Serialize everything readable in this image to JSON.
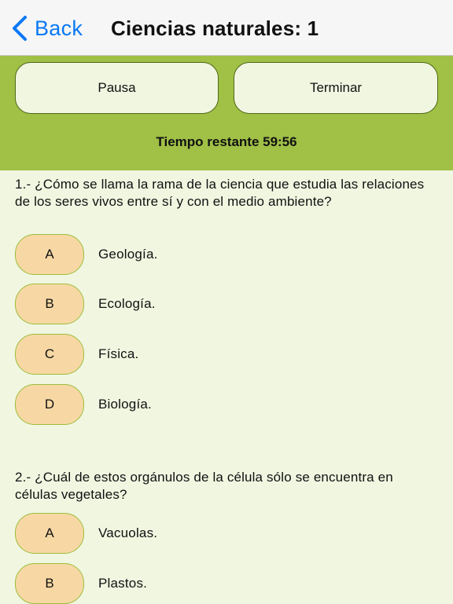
{
  "nav": {
    "back_label": "Back",
    "back_icon": "chevron-left-icon",
    "title": "Ciencias naturales: 1",
    "accent_color": "#0a78f5"
  },
  "toolbar": {
    "pause_label": "Pausa",
    "end_label": "Terminar",
    "timer_text": "Tiempo restante 59:56",
    "background_color": "#a0c046"
  },
  "questions": [
    {
      "text": "1.- ¿Cómo se llama la rama de la ciencia que estudia las relaciones de los seres vivos entre sí y con el medio ambiente?",
      "options": [
        {
          "letter": "A",
          "text": "Geología."
        },
        {
          "letter": "B",
          "text": "Ecología."
        },
        {
          "letter": "C",
          "text": "Física."
        },
        {
          "letter": "D",
          "text": "Biología."
        }
      ]
    },
    {
      "text": "2.- ¿Cuál de estos orgánulos de la célula sólo se encuentra en células vegetales?",
      "options": [
        {
          "letter": "A",
          "text": "Vacuolas."
        },
        {
          "letter": "B",
          "text": "Plastos."
        }
      ]
    }
  ]
}
